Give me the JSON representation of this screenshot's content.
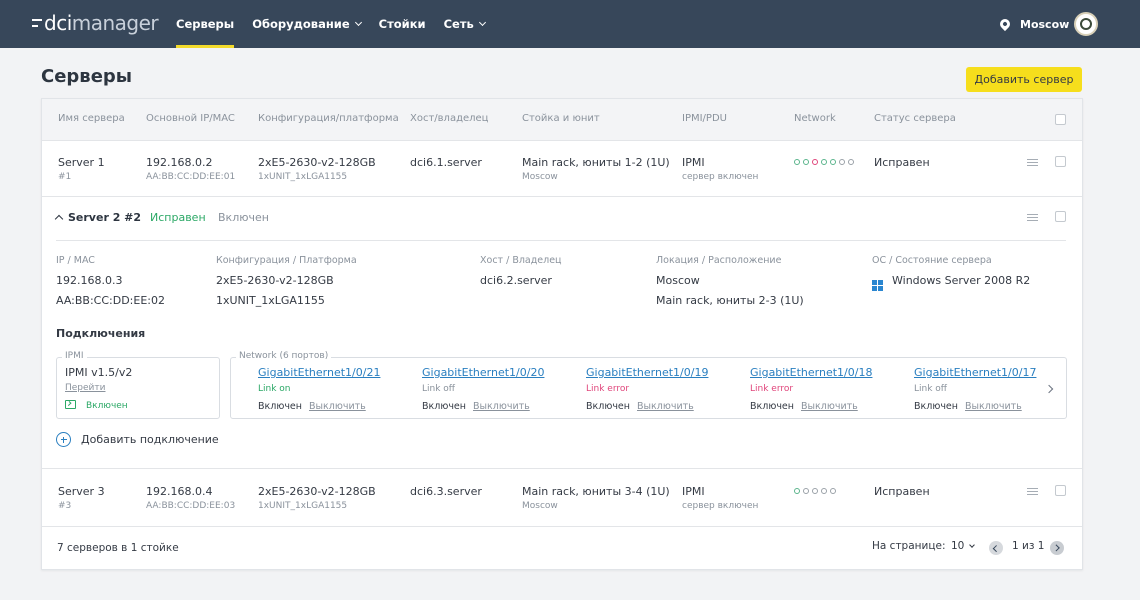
{
  "app": {
    "logo_dci": "dci",
    "logo_manager": "manager",
    "location": "Moscow"
  },
  "nav": [
    {
      "label": "Серверы",
      "active": true
    },
    {
      "label": "Оборудование",
      "dropdown": true
    },
    {
      "label": "Стойки"
    },
    {
      "label": "Сеть",
      "dropdown": true
    }
  ],
  "page": {
    "title": "Серверы",
    "add_button": "Добавить сервер"
  },
  "table": {
    "headers": [
      "Имя сервера",
      "Основной IP/MAC",
      "Конфигурация/платформа",
      "Хост/владелец",
      "Стойка и юнит",
      "IPMI/PDU",
      "Network",
      "Статус сервера"
    ],
    "rows": [
      {
        "name": "Server 1",
        "id": "#1",
        "ip": "192.168.0.2",
        "mac": "AA:BB:CC:DD:EE:01",
        "config": "2xE5-2630-v2-128GB",
        "platform": "1xUNIT_1xLGA1155",
        "host": "dci6.1.server",
        "rack": "Main rack, юниты 1-2 (1U)",
        "location": "Moscow",
        "ipmi": "IPMI",
        "ipmi_state": "сервер включен",
        "status": "Исправен"
      },
      {
        "name": "Server 3",
        "id": "#3",
        "ip": "192.168.0.4",
        "mac": "AA:BB:CC:DD:EE:03",
        "config": "2xE5-2630-v2-128GB",
        "platform": "1xUNIT_1xLGA1155",
        "host": "dci6.3.server",
        "rack": "Main rack, юниты 3-4 (1U)",
        "location": "Moscow",
        "ipmi": "IPMI",
        "ipmi_state": "сервер включен",
        "status": "Исправен"
      }
    ]
  },
  "expanded": {
    "title": "Server 2 #2",
    "status": "Исправен",
    "power": "Включен",
    "labels": {
      "ip_mac": "IP / MAC",
      "config": "Конфигурация / Платформа",
      "host": "Хост / Владелец",
      "location": "Локация / Расположение",
      "os": "ОС / Состояние сервера"
    },
    "ip": "192.168.0.3",
    "mac": "AA:BB:CC:DD:EE:02",
    "config": "2xE5-2630-v2-128GB",
    "platform": "1xUNIT_1xLGA1155",
    "host": "dci6.2.server",
    "location": "Moscow",
    "rack": "Main rack, юниты 2-3 (1U)",
    "os": "Windows Server 2008 R2",
    "connections_title": "Подключения",
    "ipmi": {
      "legend": "IPMI",
      "version": "IPMI v1.5/v2",
      "goto": "Перейти",
      "state": "Включен"
    },
    "network": {
      "legend": "Network (6 портов)",
      "on_label": "Включен",
      "off_label": "Выключить",
      "ports": [
        {
          "name": "GigabitEthernet1/0/21",
          "status": "Link on",
          "state": "on"
        },
        {
          "name": "GigabitEthernet1/0/20",
          "status": "Link off",
          "state": "off"
        },
        {
          "name": "GigabitEthernet1/0/19",
          "status": "Link error",
          "state": "error"
        },
        {
          "name": "GigabitEthernet1/0/18",
          "status": "Link error",
          "state": "error"
        },
        {
          "name": "GigabitEthernet1/0/17",
          "status": "Link off",
          "state": "off"
        }
      ]
    },
    "add_connection": "Добавить подключение"
  },
  "footer": {
    "count": "7 серверов в 1 стойке",
    "per_page_label": "На странице:",
    "per_page": "10",
    "page_info": "1 из 1"
  },
  "colors": {
    "topbar": "#37475a",
    "accent": "#f6de1c",
    "link": "#2a7fc0",
    "ok": "#2ba866",
    "error": "#e0457b"
  }
}
